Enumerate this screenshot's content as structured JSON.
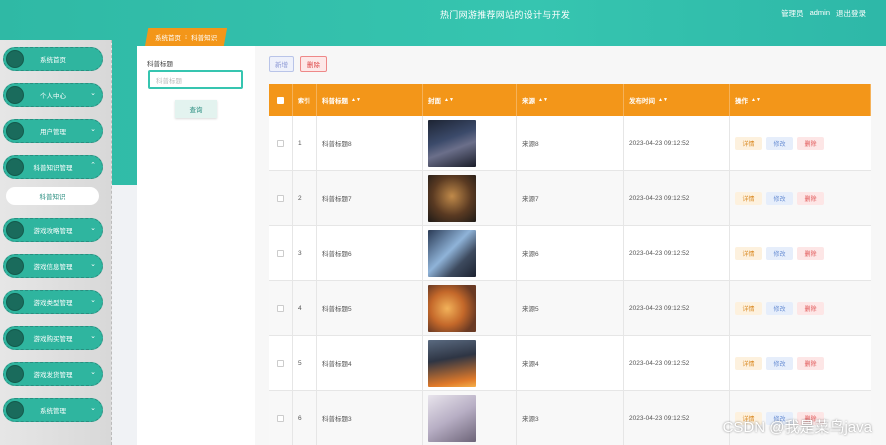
{
  "header": {
    "title": "热门网游推荐网站的设计与开发",
    "user_role": "管理员",
    "user_name": "admin",
    "logout": "退出登录"
  },
  "sidebar": {
    "items": [
      {
        "label": "系统首页",
        "chevron": ""
      },
      {
        "label": "个人中心",
        "chevron": "⌄"
      },
      {
        "label": "用户管理",
        "chevron": "⌄"
      },
      {
        "label": "科普知识管理",
        "chevron": "⌃"
      },
      {
        "label": "游戏攻略管理",
        "chevron": "⌄"
      },
      {
        "label": "游戏信息管理",
        "chevron": "⌄"
      },
      {
        "label": "游戏类型管理",
        "chevron": "⌄"
      },
      {
        "label": "游戏购买管理",
        "chevron": "⌄"
      },
      {
        "label": "游戏发货管理",
        "chevron": "⌄"
      },
      {
        "label": "系统管理",
        "chevron": "⌄"
      }
    ],
    "active_sub": "科普知识"
  },
  "breadcrumb": {
    "home": "系统首页",
    "sep": "⁝",
    "current": "科普知识"
  },
  "filter": {
    "label": "科普标题",
    "placeholder": "科普标题",
    "search_label": "查询"
  },
  "toolbar": {
    "add_label": "新增",
    "delete_label": "删除"
  },
  "table": {
    "headers": {
      "index": "索引",
      "title": "科普标题",
      "cover": "封面",
      "source": "来源",
      "publish_time": "发布时间",
      "actions": "操作"
    },
    "action_labels": {
      "detail": "详情",
      "edit": "修改",
      "delete": "删除"
    },
    "rows": [
      {
        "index": "1",
        "title": "科普标题8",
        "source": "来源8",
        "time": "2023-04-23 09:12:52"
      },
      {
        "index": "2",
        "title": "科普标题7",
        "source": "来源7",
        "time": "2023-04-23 09:12:52"
      },
      {
        "index": "3",
        "title": "科普标题6",
        "source": "来源6",
        "time": "2023-04-23 09:12:52"
      },
      {
        "index": "4",
        "title": "科普标题5",
        "source": "来源5",
        "time": "2023-04-23 09:12:52"
      },
      {
        "index": "5",
        "title": "科普标题4",
        "source": "来源4",
        "time": "2023-04-23 09:12:52"
      },
      {
        "index": "6",
        "title": "科普标题3",
        "source": "来源3",
        "time": "2023-04-23 09:12:52"
      }
    ]
  },
  "watermark": "CSDN @我是菜鸟java",
  "colors": {
    "teal": "#36c5b0",
    "orange": "#f39619",
    "sidebar_dark": "#1a6b5c"
  }
}
